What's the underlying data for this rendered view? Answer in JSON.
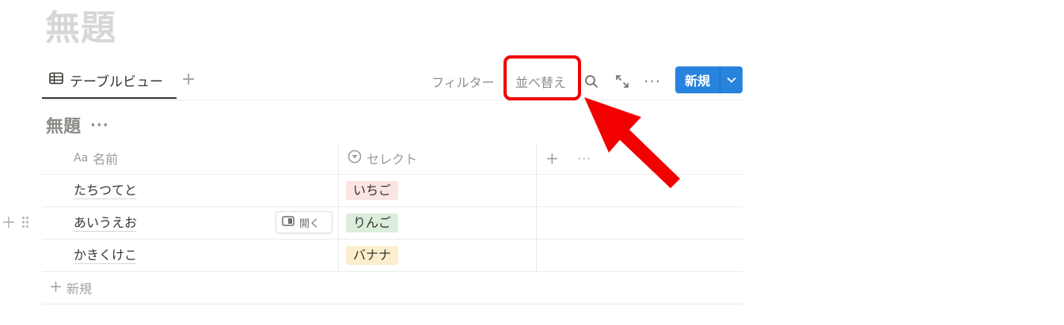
{
  "page": {
    "title": "無題"
  },
  "view_bar": {
    "tab_label": "テーブルビュー",
    "add_view": "+",
    "filter_label": "フィルター",
    "sort_label": "並べ替え",
    "more": "···",
    "new_label": "新規"
  },
  "database": {
    "title": "無題",
    "more": "···",
    "columns": [
      {
        "label": "名前",
        "icon_text": "Aa"
      },
      {
        "label": "セレクト",
        "icon": "select-icon"
      }
    ],
    "add_column": "+",
    "column_more": "···",
    "rows": [
      {
        "name": "たちつてと",
        "tag": "いちご",
        "tag_color": "#fbe4e4"
      },
      {
        "name": "あいうえお",
        "tag": "りんご",
        "tag_color": "#dbeddb"
      },
      {
        "name": "かきくけこ",
        "tag": "バナナ",
        "tag_color": "#fbeecc"
      }
    ],
    "open_label": "開く",
    "new_row_label": "新規"
  },
  "colors": {
    "accent": "#2783de",
    "highlight": "#f20000"
  }
}
